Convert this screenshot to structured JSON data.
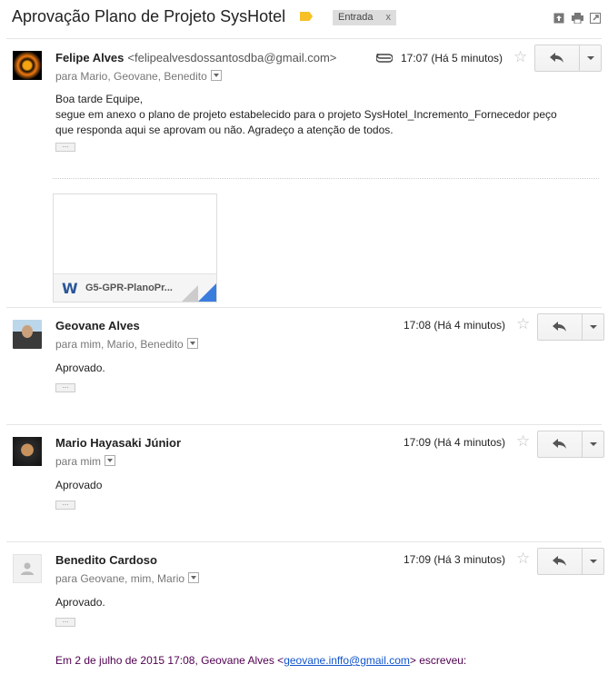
{
  "thread": {
    "subject": "Aprovação Plano de Projeto SysHotel",
    "label_chip": "Entrada",
    "label_remove": "x"
  },
  "messages": [
    {
      "sender": "Felipe Alves",
      "email": "<felipealvesdossantosdba@gmail.com>",
      "recipients": "para Mario, Geovane, Benedito",
      "time": "17:07 (Há 5 minutos)",
      "body": [
        "Boa tarde Equipe,",
        "segue em anexo o plano de projeto estabelecido para o projeto SysHotel_Incremento_Fornecedor peço",
        "que responda aqui se aprovam ou não. Agradeço a atenção de todos."
      ],
      "attachment": "G5-GPR-PlanoPr..."
    },
    {
      "sender": "Geovane Alves",
      "recipients": "para mim, Mario, Benedito",
      "time": "17:08 (Há 4 minutos)",
      "body": "Aprovado."
    },
    {
      "sender": "Mario Hayasaki Júnior",
      "recipients": "para mim",
      "time": "17:09 (Há 4 minutos)",
      "body": "Aprovado"
    },
    {
      "sender": "Benedito Cardoso",
      "recipients": "para Geovane, mim, Mario",
      "time": "17:09 (Há 3 minutos)",
      "body": "Aprovado.",
      "quote_prefix": "Em 2 de julho de 2015 17:08, Geovane Alves <",
      "quote_email": "geovane.inffo@gmail.com",
      "quote_suffix": "> escreveu:"
    }
  ],
  "icons": {
    "label": "label-tag-icon",
    "newwindow": "new-window-icon",
    "print": "print-icon",
    "popout": "popout-icon",
    "attach": "paperclip-icon",
    "star": "star-icon",
    "reply": "reply-icon",
    "more": "chevron-down-icon"
  },
  "colors": {
    "label_tag": "#f6c026",
    "link": "#1155cc",
    "quote": "#500050",
    "word_blue": "#2a5699"
  }
}
